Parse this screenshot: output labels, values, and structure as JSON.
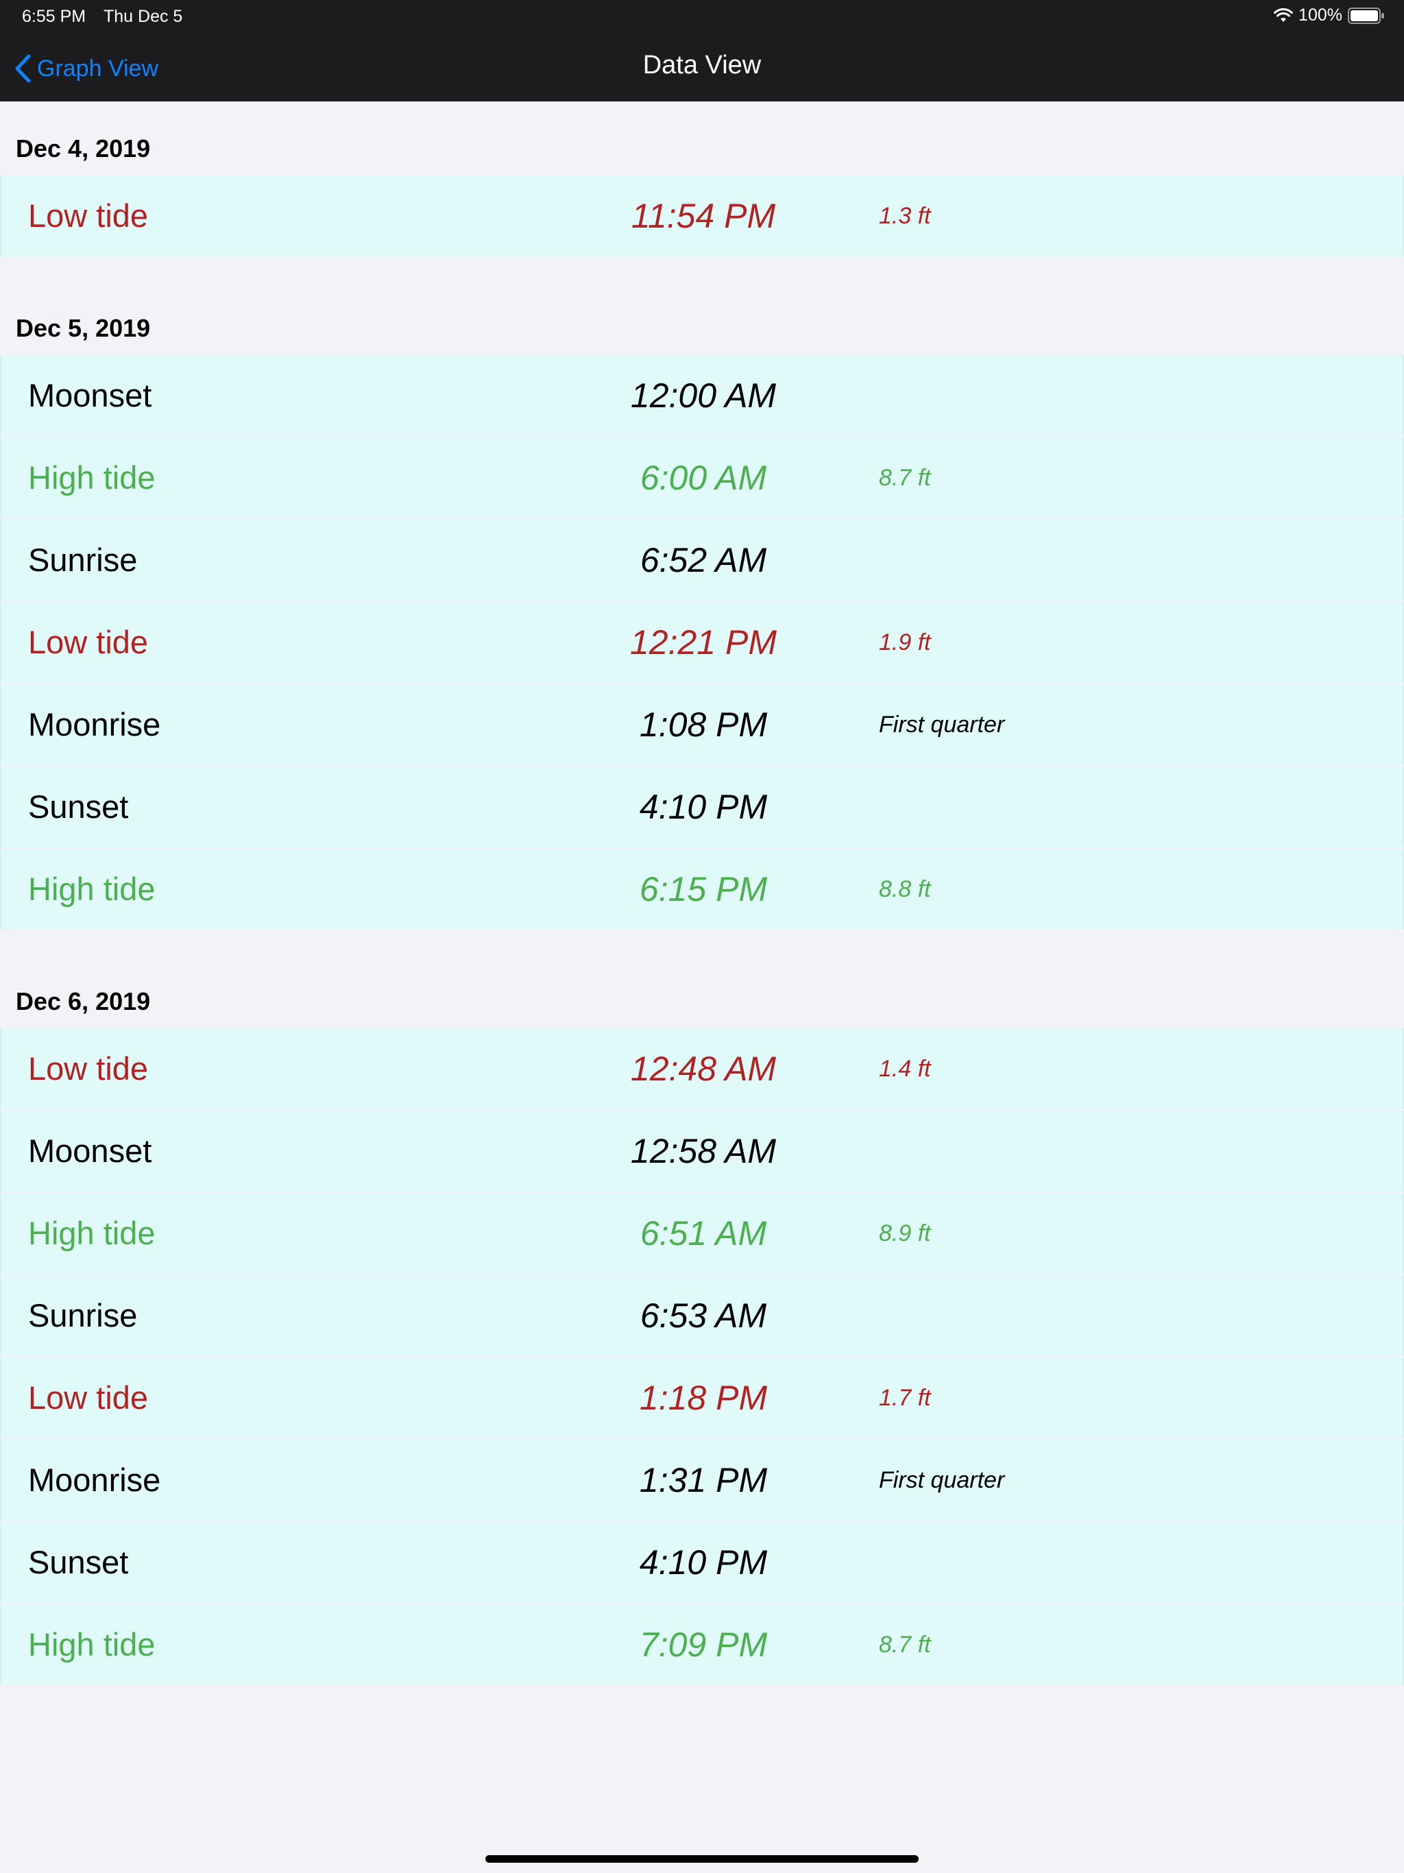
{
  "status_bar": {
    "time": "6:55 PM",
    "date": "Thu Dec 5",
    "battery": "100%"
  },
  "nav": {
    "back_label": "Graph View",
    "title": "Data View"
  },
  "colors": {
    "low_tide": "#b22222",
    "high_tide": "#4caf50",
    "row_background": "#e0f9f9",
    "back_link": "#0a84ff"
  },
  "sections": [
    {
      "date": "Dec 4, 2019",
      "rows": [
        {
          "event": "Low tide",
          "time": "11:54 PM",
          "detail": "1.3 ft",
          "kind": "low"
        }
      ]
    },
    {
      "date": "Dec 5, 2019",
      "rows": [
        {
          "event": "Moonset",
          "time": "12:00 AM",
          "detail": "",
          "kind": "plain"
        },
        {
          "event": "High tide",
          "time": "6:00 AM",
          "detail": "8.7 ft",
          "kind": "high"
        },
        {
          "event": "Sunrise",
          "time": "6:52 AM",
          "detail": "",
          "kind": "plain"
        },
        {
          "event": "Low tide",
          "time": "12:21 PM",
          "detail": "1.9 ft",
          "kind": "low"
        },
        {
          "event": "Moonrise",
          "time": "1:08 PM",
          "detail": "First quarter",
          "kind": "plain"
        },
        {
          "event": "Sunset",
          "time": "4:10 PM",
          "detail": "",
          "kind": "plain"
        },
        {
          "event": "High tide",
          "time": "6:15 PM",
          "detail": "8.8 ft",
          "kind": "high"
        }
      ]
    },
    {
      "date": "Dec 6, 2019",
      "rows": [
        {
          "event": "Low tide",
          "time": "12:48 AM",
          "detail": "1.4 ft",
          "kind": "low"
        },
        {
          "event": "Moonset",
          "time": "12:58 AM",
          "detail": "",
          "kind": "plain"
        },
        {
          "event": "High tide",
          "time": "6:51 AM",
          "detail": "8.9 ft",
          "kind": "high"
        },
        {
          "event": "Sunrise",
          "time": "6:53 AM",
          "detail": "",
          "kind": "plain"
        },
        {
          "event": "Low tide",
          "time": "1:18 PM",
          "detail": "1.7 ft",
          "kind": "low"
        },
        {
          "event": "Moonrise",
          "time": "1:31 PM",
          "detail": "First quarter",
          "kind": "plain"
        },
        {
          "event": "Sunset",
          "time": "4:10 PM",
          "detail": "",
          "kind": "plain"
        },
        {
          "event": "High tide",
          "time": "7:09 PM",
          "detail": "8.7 ft",
          "kind": "high"
        }
      ]
    }
  ]
}
